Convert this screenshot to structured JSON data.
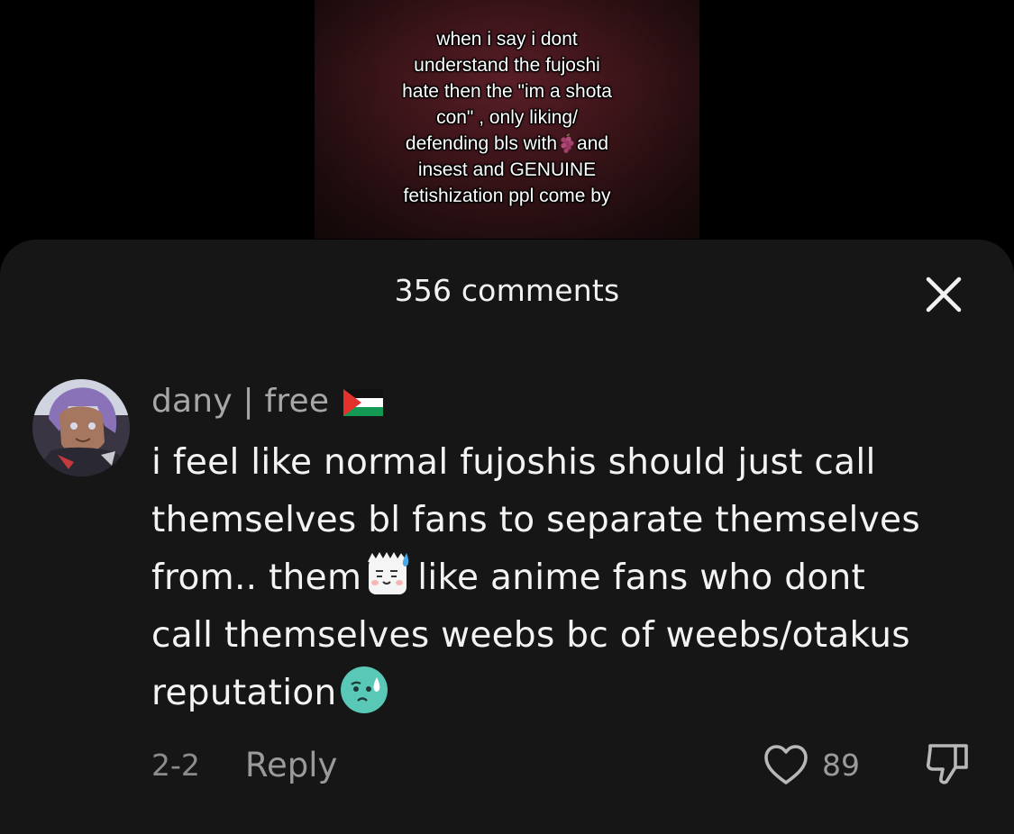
{
  "video": {
    "overlay_lines": [
      "when i say i dont",
      "understand the fujoshi",
      "hate then the \"im a shota",
      "con\" , only liking/",
      "defending bls with",
      "and",
      "insest and GENUINE",
      "fetishization ppl come by"
    ],
    "overlay_emoji": "grapes-emoji"
  },
  "comments_sheet": {
    "title": "356 comments",
    "close_icon": "close-icon"
  },
  "comment": {
    "avatar": "anime-avatar",
    "username": "dany | free",
    "username_flag": "palestine-flag",
    "text_lines": [
      "i feel like normal fujoshis should just call",
      "themselves bl fans to separate themselves",
      "from.. them",
      "like anime fans who dont",
      "call themselves weebs bc of weebs/otakus",
      "reputation"
    ],
    "emoji_1": "sweat-smile-emoji",
    "emoji_2": "sad-sweat-emoji",
    "date": "2-2",
    "reply_label": "Reply",
    "like_count": "89",
    "like_icon": "heart-icon",
    "dislike_icon": "thumbs-down-icon"
  },
  "colors": {
    "page_bg": "#000000",
    "sheet_bg": "#161616",
    "primary_text": "#f3f3f3",
    "secondary_text": "#a7a7a7",
    "muted_text": "#8c8c8c",
    "emoji_teal": "#5ac8b7"
  }
}
